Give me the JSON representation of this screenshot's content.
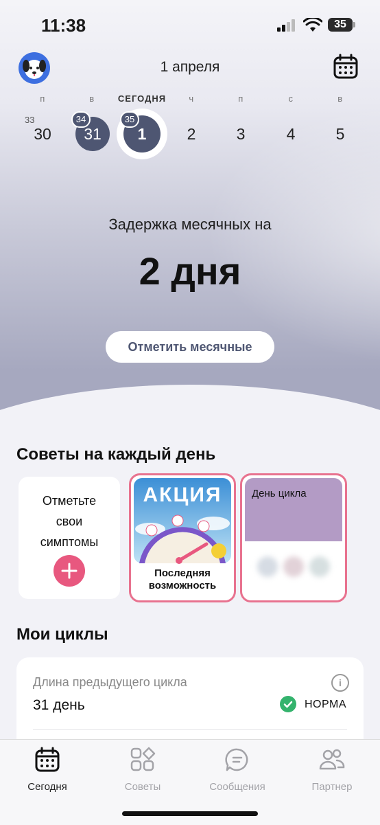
{
  "status_bar": {
    "time": "11:38",
    "battery": "35"
  },
  "header": {
    "date": "1 апреля"
  },
  "week": {
    "weekdays": [
      "п",
      "в",
      "СЕГОДНЯ",
      "ч",
      "п",
      "с",
      "в"
    ],
    "dates": [
      "30",
      "31",
      "1",
      "2",
      "3",
      "4",
      "5"
    ],
    "cycle_days": [
      "33",
      "34",
      "35"
    ]
  },
  "hero": {
    "delay_label": "Задержка месячных на",
    "delay_value": "2 дня",
    "mark_button": "Отметить месячные"
  },
  "tips": {
    "title": "Советы на каждый день",
    "symptoms_card": "Отметьте свои симптомы",
    "promo_badge": "АКЦИЯ",
    "promo_caption": "Последняя возможность",
    "cycle_day_card": "День цикла"
  },
  "cycles": {
    "title": "Мои циклы",
    "prev_label": "Длина предыдущего цикла",
    "prev_value": "31 день",
    "status": "НОРМА"
  },
  "tabs": [
    {
      "label": "Сегодня",
      "icon": "calendar-icon"
    },
    {
      "label": "Советы",
      "icon": "grid-shapes-icon"
    },
    {
      "label": "Сообщения",
      "icon": "chat-icon"
    },
    {
      "label": "Партнер",
      "icon": "people-icon"
    }
  ],
  "colors": {
    "accent": "#4e5672",
    "pink": "#e8587f",
    "norma_green": "#34b36d",
    "avatar_blue": "#3d6fe0"
  }
}
